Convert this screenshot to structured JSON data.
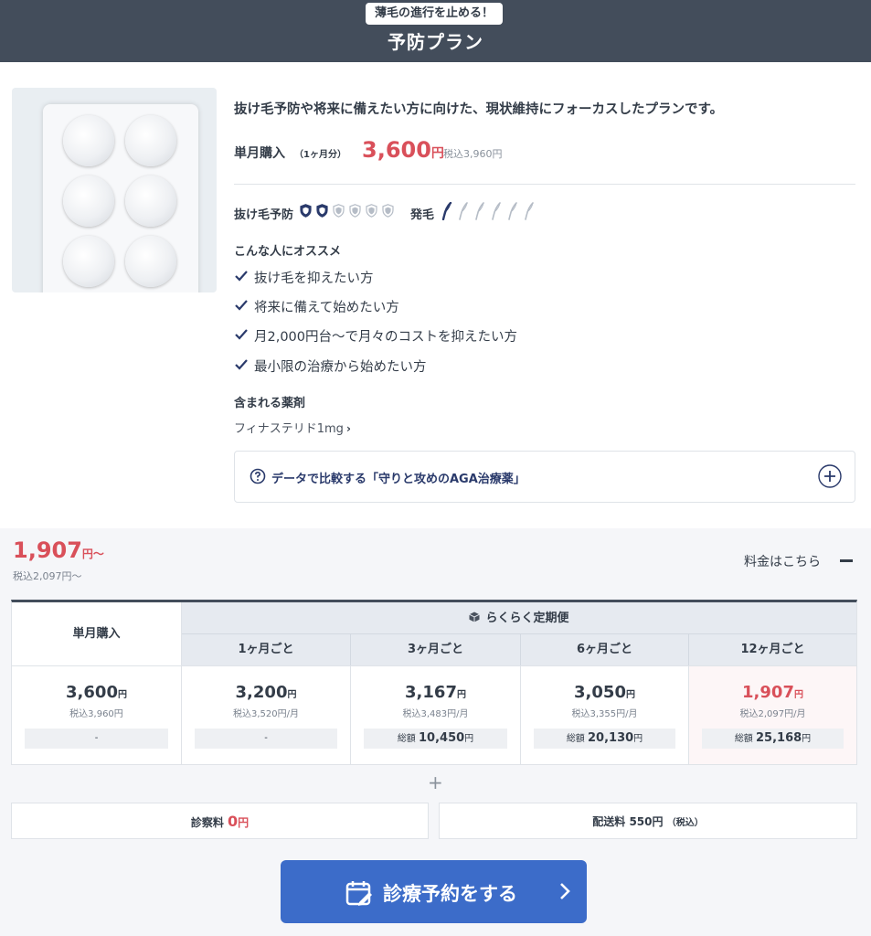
{
  "header": {
    "badge": "薄毛の進行を止める！",
    "title": "予防プラン"
  },
  "plan": {
    "description": "抜け毛予防や将来に備えたい方に向けた、現状維持にフォーカスしたプランです。",
    "single_label": "単月購入",
    "single_sub": "（1ヶ月分）",
    "single_price": "3,600",
    "yen": "円",
    "single_tax": "税込3,960円"
  },
  "rating": {
    "prevent_label": "抜け毛予防",
    "prevent_level": 2,
    "prevent_max": 6,
    "growth_label": "発毛",
    "growth_level": 1,
    "growth_max": 6
  },
  "recommend": {
    "title": "こんな人にオススメ",
    "items": [
      "抜け毛を抑えたい方",
      "将来に備えて始めたい方",
      "月2,000円台〜で月々のコストを抑えたい方",
      "最小限の治療から始めたい方"
    ]
  },
  "medicine": {
    "title": "含まれる薬剤",
    "link": "フィナステリド1mg"
  },
  "compare": {
    "label": "データで比較する「守りと攻めのAGA治療薬」"
  },
  "pricing": {
    "from_price": "1,907",
    "from_suffix": "円〜",
    "from_tax": "税込2,097円〜",
    "toggle_label": "料金はこちら",
    "single_head": "単月購入",
    "sub_head": "らくらく定期便",
    "columns": [
      {
        "head": "単月購入",
        "price": "3,600",
        "tax": "税込3,960円",
        "total_label": "",
        "total_value": "-"
      },
      {
        "head": "1ヶ月ごと",
        "price": "3,200",
        "tax": "税込3,520円/月",
        "total_label": "",
        "total_value": "-"
      },
      {
        "head": "3ヶ月ごと",
        "price": "3,167",
        "tax": "税込3,483円/月",
        "total_label": "総額",
        "total_value": "10,450"
      },
      {
        "head": "6ヶ月ごと",
        "price": "3,050",
        "tax": "税込3,355円/月",
        "total_label": "総額",
        "total_value": "20,130"
      },
      {
        "head": "12ヶ月ごと",
        "price": "1,907",
        "tax": "税込2,097円/月",
        "total_label": "総額",
        "total_value": "25,168"
      }
    ],
    "plus": "+",
    "consult_label": "診察料",
    "consult_value": "0",
    "shipping_label": "配送料 550円",
    "shipping_note": "（税込）"
  },
  "cta": {
    "label": "診療予約をする"
  },
  "colors": {
    "accent": "#d9505a",
    "navy": "#434d5b",
    "cta": "#3c6cc9"
  }
}
